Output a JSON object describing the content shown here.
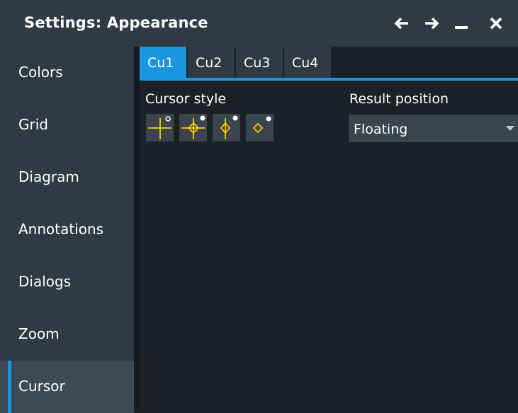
{
  "window": {
    "title": "Settings: Appearance",
    "buttons": {
      "back": "back-arrow-icon",
      "forward": "forward-arrow-icon",
      "minimize": "minimize-icon",
      "close": "close-icon"
    }
  },
  "sidebar": {
    "items": [
      {
        "label": "Colors",
        "active": false
      },
      {
        "label": "Grid",
        "active": false
      },
      {
        "label": "Diagram",
        "active": false
      },
      {
        "label": "Annotations",
        "active": false
      },
      {
        "label": "Dialogs",
        "active": false
      },
      {
        "label": "Zoom",
        "active": false
      },
      {
        "label": "Cursor",
        "active": true
      }
    ]
  },
  "tabs": [
    {
      "label": "Cu1",
      "active": true
    },
    {
      "label": "Cu2",
      "active": false
    },
    {
      "label": "Cu3",
      "active": false
    },
    {
      "label": "Cu4",
      "active": false
    }
  ],
  "cursor_style": {
    "label": "Cursor style",
    "options": [
      "crosshair-cursor-icon",
      "crosshair-diamond-cursor-icon",
      "vertical-diamond-cursor-icon",
      "diamond-cursor-icon"
    ]
  },
  "result_position": {
    "label": "Result position",
    "value": "Floating"
  },
  "colors": {
    "accent": "#1a95e0",
    "cursor_yellow": "#e8c000",
    "panel": "#2f3a45",
    "background": "#1c2127"
  }
}
